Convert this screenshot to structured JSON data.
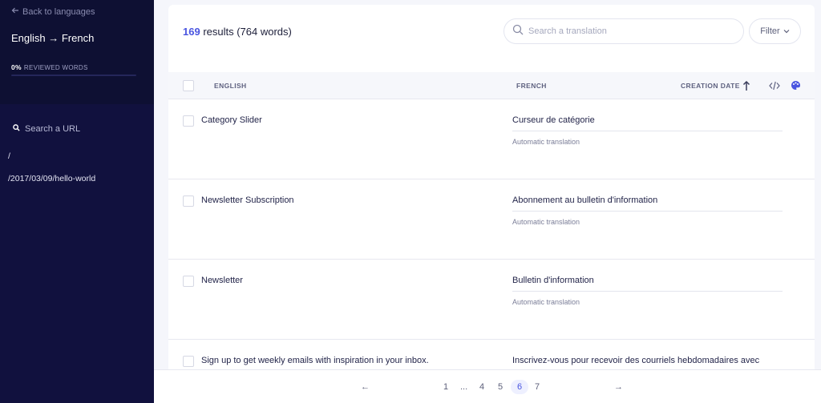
{
  "sidebar": {
    "back_label": "Back to languages",
    "language_pair": "English → French",
    "reviewed_percent": "0%",
    "reviewed_label": "REVIEWED WORDS",
    "reviewed_fraction": 0,
    "search_url_label": "Search a URL",
    "urls": [
      "/",
      "/2017/03/09/hello-world"
    ]
  },
  "header": {
    "results_count": "169",
    "results_suffix": "results (764 words)",
    "search_placeholder": "Search a translation",
    "filter_label": "Filter"
  },
  "table": {
    "columns": {
      "english": "ENGLISH",
      "french": "FRENCH",
      "creation_date": "CREATION DATE"
    },
    "rows": [
      {
        "source": "Category Slider",
        "target": "Curseur de catégorie",
        "status": "Automatic translation"
      },
      {
        "source": "Newsletter Subscription",
        "target": "Abonnement au bulletin d'information",
        "status": "Automatic translation"
      },
      {
        "source": "Newsletter",
        "target": "Bulletin d'information",
        "status": "Automatic translation"
      },
      {
        "source": "Sign up to get weekly emails with inspiration in your inbox.",
        "target": "Inscrivez-vous pour recevoir des courriels hebdomadaires avec",
        "status": ""
      }
    ]
  },
  "pagination": {
    "prev": "←",
    "next": "→",
    "pages": [
      "1",
      "...",
      "4",
      "5",
      "6",
      "7"
    ],
    "current": "6"
  },
  "colors": {
    "accent": "#4a55e0",
    "sidebar_bg": "#11113e"
  },
  "icons": {
    "back": "arrow-left-icon",
    "search": "search-icon",
    "filter": "chevron-down-icon",
    "sort": "arrow-up-icon",
    "code": "code-icon",
    "palette": "palette-icon"
  }
}
